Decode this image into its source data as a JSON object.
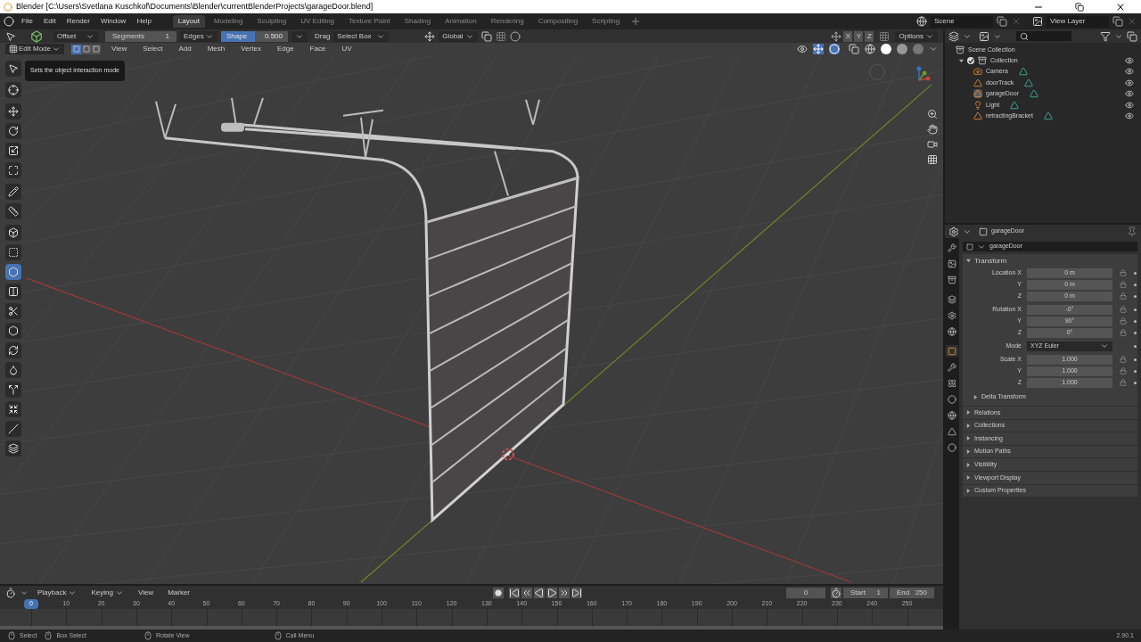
{
  "window": {
    "title": "Blender [C:\\Users\\Svetlana Kuschkof\\Documents\\Blender\\currentBlenderProjects\\garageDoor.blend]"
  },
  "menus": [
    "File",
    "Edit",
    "Render",
    "Window",
    "Help"
  ],
  "workspaces": [
    {
      "label": "Layout",
      "selected": true
    },
    {
      "label": "Modeling",
      "selected": false
    },
    {
      "label": "Sculpting",
      "selected": false
    },
    {
      "label": "UV Editing",
      "selected": false
    },
    {
      "label": "Texture Paint",
      "selected": false
    },
    {
      "label": "Shading",
      "selected": false
    },
    {
      "label": "Animation",
      "selected": false
    },
    {
      "label": "Rendering",
      "selected": false
    },
    {
      "label": "Compositing",
      "selected": false
    },
    {
      "label": "Scripting",
      "selected": false
    }
  ],
  "scene": "Scene",
  "view_layer": "View Layer",
  "tool_settings": {
    "offset": "Offset",
    "segments_label": "Segments",
    "segments": "1",
    "edges": "Edges",
    "shape": {
      "label": "Shape",
      "value": "0.500",
      "level": 0.5
    },
    "drag_label": "Drag",
    "drag": "Select Box",
    "orientation": "Global",
    "axes": [
      "X",
      "Y",
      "Z"
    ],
    "options": "Options"
  },
  "header": {
    "mode": "Edit Mode",
    "select_modes": [
      {
        "selected": true
      },
      {
        "selected": false
      },
      {
        "selected": false
      }
    ],
    "menus": [
      "View",
      "Select",
      "Add",
      "Mesh",
      "Vertex",
      "Edge",
      "Face",
      "UV"
    ]
  },
  "tooltip": "Sets the object interaction mode",
  "tools": [
    {
      "selected": false
    },
    {
      "selected": false
    },
    {
      "selected": false
    },
    {
      "selected": false
    },
    {
      "selected": false
    },
    {
      "selected": false
    },
    {
      "selected": false
    },
    {
      "selected": false
    },
    {
      "selected": false
    },
    {
      "selected": false
    },
    {
      "selected": true
    },
    {
      "selected": false
    },
    {
      "selected": false
    },
    {
      "selected": false
    },
    {
      "selected": false
    },
    {
      "selected": false
    },
    {
      "selected": false
    },
    {
      "selected": false
    },
    {
      "selected": false
    },
    {
      "selected": false
    }
  ],
  "outliner": {
    "root": "Scene Collection",
    "collection": {
      "name": "Collection",
      "checked": true,
      "expanded": true,
      "children": [
        {
          "name": "Camera",
          "kind": "camera",
          "selected": false
        },
        {
          "name": "doorTrack",
          "kind": "mesh",
          "selected": false
        },
        {
          "name": "garageDoor",
          "kind": "mesh",
          "selected": true
        },
        {
          "name": "Light",
          "kind": "light",
          "selected": false
        },
        {
          "name": "retractingBracket",
          "kind": "mesh",
          "selected": false
        }
      ]
    }
  },
  "properties": {
    "tabs": [
      {
        "selected": false
      },
      {
        "selected": false
      },
      {
        "selected": false
      },
      {
        "selected": false
      },
      {
        "selected": false
      },
      {
        "selected": false
      },
      {
        "selected": true
      },
      {
        "selected": false
      },
      {
        "selected": false
      },
      {
        "selected": false
      },
      {
        "selected": false
      },
      {
        "selected": false
      },
      {
        "selected": false
      }
    ],
    "object": "garageDoor",
    "datablock": "garageDoor",
    "section": "Transform",
    "expanded": true,
    "groups": [
      {
        "kind": "fields",
        "rows": [
          {
            "label": "Location X",
            "value": "0 m"
          },
          {
            "label": "Y",
            "value": "0 m"
          },
          {
            "label": "Z",
            "value": "0 m"
          }
        ]
      },
      {
        "kind": "fields",
        "rows": [
          {
            "label": "Rotation X",
            "value": "-0°"
          },
          {
            "label": "Y",
            "value": "90°"
          },
          {
            "label": "Z",
            "value": "0°"
          }
        ]
      },
      {
        "kind": "select",
        "rows": [
          {
            "label": "Mode",
            "value": "XYZ Euler"
          }
        ]
      },
      {
        "kind": "fields",
        "rows": [
          {
            "label": "Scale X",
            "value": "1.000"
          },
          {
            "label": "Y",
            "value": "1.000"
          },
          {
            "label": "Z",
            "value": "1.000"
          }
        ]
      }
    ],
    "subsection": {
      "label": "Delta Transform",
      "expanded": false
    },
    "sections": [
      {
        "label": "Relations",
        "expanded": false
      },
      {
        "label": "Collections",
        "expanded": false
      },
      {
        "label": "Instancing",
        "expanded": false
      },
      {
        "label": "Motion Paths",
        "expanded": false
      },
      {
        "label": "Visibility",
        "expanded": false
      },
      {
        "label": "Viewport Display",
        "expanded": false
      },
      {
        "label": "Custom Properties",
        "expanded": false
      }
    ]
  },
  "timeline": {
    "menus": [
      "Playback",
      "Keying",
      "View",
      "Marker"
    ],
    "current": "0",
    "start_label": "Start",
    "start": "1",
    "end_label": "End",
    "end": "250",
    "ticks": [
      "0",
      "10",
      "20",
      "30",
      "40",
      "50",
      "60",
      "70",
      "80",
      "90",
      "100",
      "110",
      "120",
      "130",
      "140",
      "150",
      "160",
      "170",
      "180",
      "190",
      "200",
      "210",
      "220",
      "230",
      "240",
      "250"
    ]
  },
  "status_bar": {
    "items": [
      "Select",
      "Box Select",
      "Rotate View",
      "Call Menu"
    ],
    "version": "2.90.1"
  }
}
